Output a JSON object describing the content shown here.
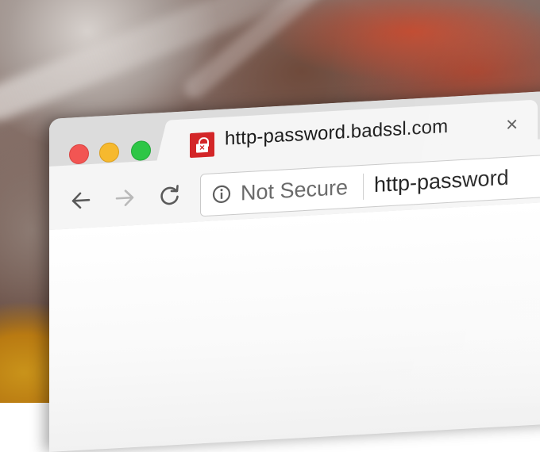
{
  "window": {
    "traffic_lights": [
      {
        "name": "close",
        "color": "#f25553"
      },
      {
        "name": "minimize",
        "color": "#f6b92e"
      },
      {
        "name": "zoom",
        "color": "#2dc646"
      }
    ]
  },
  "tab": {
    "title": "http-password.badssl.com",
    "favicon_icon": "red-padlock-x-icon",
    "favicon_color": "#d32628",
    "close_glyph": "×"
  },
  "toolbar": {
    "back_icon": "arrow-left-icon",
    "forward_icon": "arrow-right-icon",
    "reload_icon": "reload-icon"
  },
  "omnibox": {
    "security_icon": "info-circle-icon",
    "security_label": "Not Secure",
    "url": "http-password"
  }
}
